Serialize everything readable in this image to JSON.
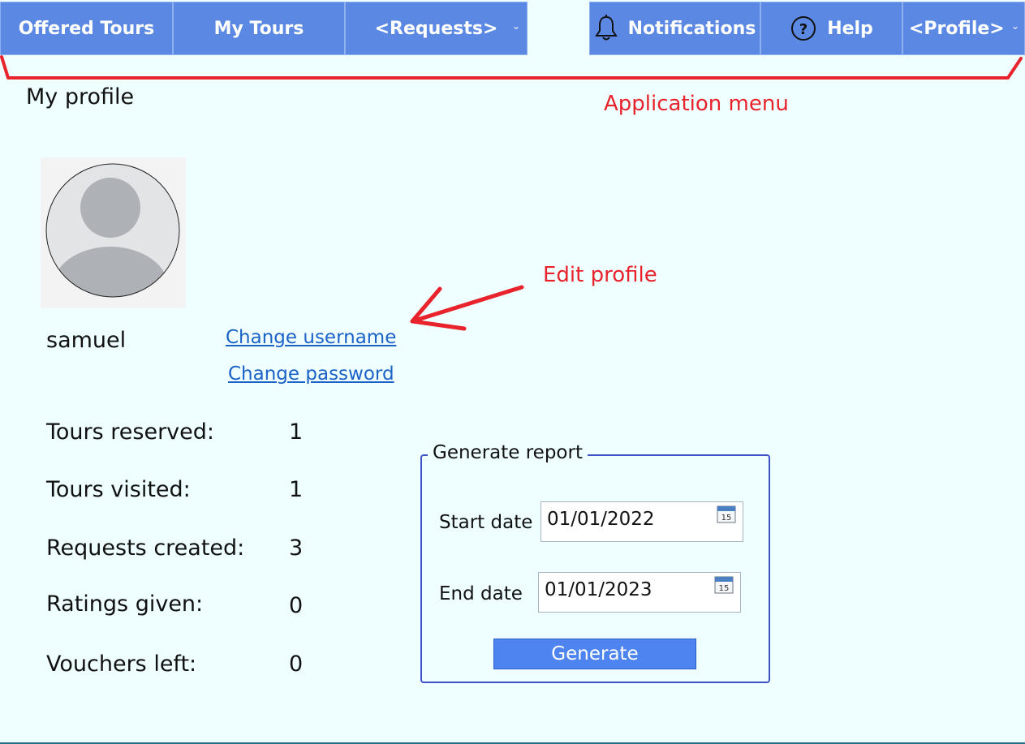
{
  "nav": {
    "offered_tours": "Offered Tours",
    "my_tours": "My Tours",
    "requests": "<Requests>",
    "notifications": "Notifications",
    "help": "Help",
    "profile": "<Profile>"
  },
  "annotations": {
    "application_menu": "Application menu",
    "edit_profile": "Edit profile"
  },
  "page": {
    "title": "My profile"
  },
  "profile": {
    "username": "samuel",
    "change_username": "Change username",
    "change_password": "Change password"
  },
  "stats": [
    {
      "label": "Tours reserved:",
      "value": "1"
    },
    {
      "label": "Tours visited:",
      "value": "1"
    },
    {
      "label": "Requests created:",
      "value": "3"
    },
    {
      "label": "Ratings given:",
      "value": "0"
    },
    {
      "label": "Vouchers left:",
      "value": "0"
    }
  ],
  "report": {
    "legend": "Generate report",
    "start_label": "Start date",
    "start_value": "01/01/2022",
    "end_label": "End date",
    "end_value": "01/01/2023",
    "calendar_day": "15",
    "generate_label": "Generate"
  },
  "colors": {
    "background": "#efffff",
    "nav_button": "#5b88e3",
    "annotation": "#e8232c",
    "link": "#1a62c8",
    "generate_button": "#4d84f0",
    "group_border": "#3d52c9"
  },
  "icons": [
    "bell-icon",
    "help-circle-icon",
    "chevron-down-icon",
    "calendar-icon",
    "avatar-placeholder"
  ]
}
